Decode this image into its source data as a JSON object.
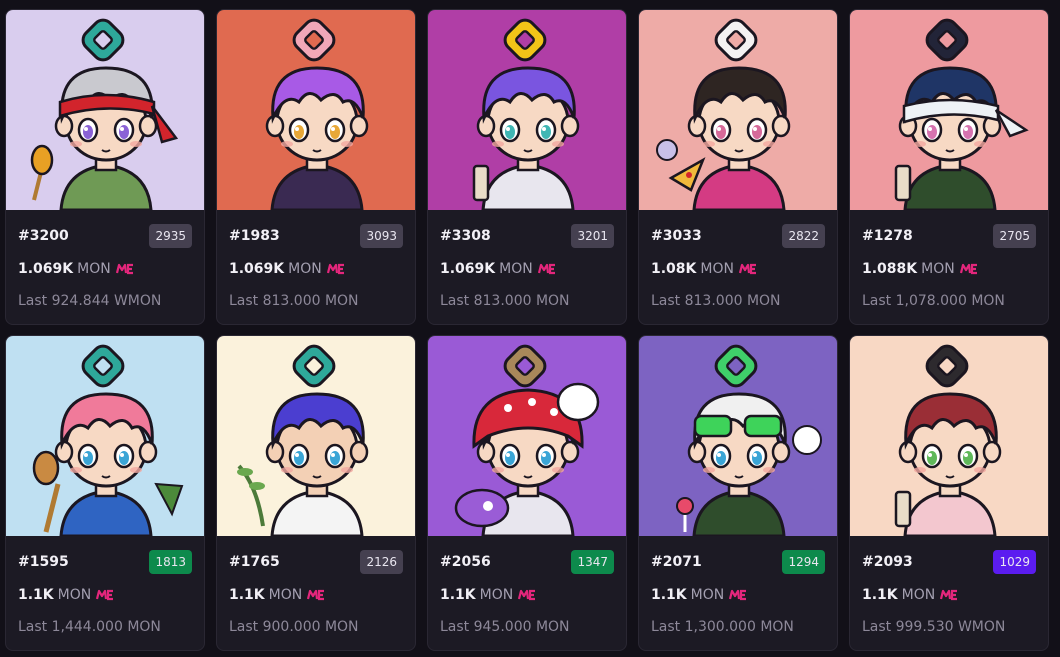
{
  "colors": {
    "page_bg": "#121018",
    "card_bg": "#1c1a24",
    "rank_default": "#454050",
    "rank_green": "#0d8a4c",
    "rank_purple": "#5b1cf0",
    "marketplace_brand": "#e4267c"
  },
  "icons": {
    "marketplace": "magic-eden-logo-icon"
  },
  "cards": [
    {
      "id": "#3200",
      "rank": "2935",
      "rank_style": "default",
      "price": "1.069K",
      "currency": "MON",
      "last": "Last 924.844 WMON",
      "art": {
        "bg": "#d9cdee",
        "hair": "#c9c9cf",
        "skin": "#f7d9c4",
        "shirt": "#6f9a55",
        "accessory": "red-bandana",
        "ring": "#2ea89a",
        "prop": "honey-dipper",
        "eyes": "#8a62d6"
      }
    },
    {
      "id": "#1983",
      "rank": "3093",
      "rank_style": "default",
      "price": "1.069K",
      "currency": "MON",
      "last": "Last 813.000 MON",
      "art": {
        "bg": "#e06a50",
        "hair": "#a85ae6",
        "skin": "#f7d9c4",
        "shirt": "#3a2a52",
        "accessory": "none",
        "ring": "#f1a7b8",
        "prop": "none",
        "eyes": "#e8a838"
      }
    },
    {
      "id": "#3308",
      "rank": "3201",
      "rank_style": "default",
      "price": "1.069K",
      "currency": "MON",
      "last": "Last 813.000 MON",
      "art": {
        "bg": "#b03ea6",
        "hair": "#7a55e0",
        "skin": "#f7d9c4",
        "shirt": "#e8e6ee",
        "accessory": "none",
        "ring": "#f2c418",
        "prop": "drink",
        "eyes": "#3fb6b4"
      }
    },
    {
      "id": "#3033",
      "rank": "2822",
      "rank_style": "default",
      "price": "1.08K",
      "currency": "MON",
      "last": "Last 813.000 MON",
      "art": {
        "bg": "#eeaba7",
        "hair": "#2e2522",
        "skin": "#f7d9c4",
        "shirt": "#d43b83",
        "accessory": "none",
        "ring": "#f4f2f2",
        "prop": "pizza",
        "eyes": "#d66a9a"
      }
    },
    {
      "id": "#1278",
      "rank": "2705",
      "rank_style": "default",
      "price": "1.088K",
      "currency": "MON",
      "last": "Last 1,078.000 MON",
      "art": {
        "bg": "#ee9a9f",
        "hair": "#1f3566",
        "skin": "#f7d9c4",
        "shirt": "#2f4d2c",
        "accessory": "white-bandage",
        "ring": "#222438",
        "prop": "scroll",
        "eyes": "#d673b0"
      }
    },
    {
      "id": "#1595",
      "rank": "1813",
      "rank_style": "green",
      "price": "1.1K",
      "currency": "MON",
      "last": "Last 1,444.000 MON",
      "art": {
        "bg": "#bfe0f2",
        "hair": "#f07a9a",
        "skin": "#f7d9c4",
        "shirt": "#2f64c2",
        "accessory": "none",
        "ring": "#2ea89a",
        "prop": "spoon",
        "eyes": "#3aa5d6"
      }
    },
    {
      "id": "#1765",
      "rank": "2126",
      "rank_style": "default",
      "price": "1.1K",
      "currency": "MON",
      "last": "Last 900.000 MON",
      "art": {
        "bg": "#fbf2dc",
        "hair": "#4b3ed0",
        "skin": "#f3d0b5",
        "shirt": "#f4f4f4",
        "accessory": "none",
        "ring": "#2ea89a",
        "prop": "branch",
        "eyes": "#3aa5d6"
      }
    },
    {
      "id": "#2056",
      "rank": "1347",
      "rank_style": "green",
      "price": "1.1K",
      "currency": "MON",
      "last": "Last 945.000 MON",
      "art": {
        "bg": "#9a5ad6",
        "hair": "#3b2f3f",
        "skin": "#f7d9c4",
        "shirt": "#e8e6ee",
        "accessory": "red-helmet",
        "ring": "#a8885a",
        "prop": "pet",
        "eyes": "#3aa5d6"
      }
    },
    {
      "id": "#2071",
      "rank": "1294",
      "rank_style": "green",
      "price": "1.1K",
      "currency": "MON",
      "last": "Last 1,300.000 MON",
      "art": {
        "bg": "#7d63c2",
        "hair": "#f0f0f0",
        "skin": "#f7d9c4",
        "shirt": "#2f4d2c",
        "accessory": "green-goggles",
        "ring": "#3fcf6a",
        "prop": "lollipop",
        "eyes": "#3aa5d6"
      }
    },
    {
      "id": "#2093",
      "rank": "1029",
      "rank_style": "purple",
      "price": "1.1K",
      "currency": "MON",
      "last": "Last 999.530 WMON",
      "art": {
        "bg": "#f8d8c4",
        "hair": "#9a2e36",
        "skin": "#f7d9c4",
        "shirt": "#f3c7cf",
        "accessory": "none",
        "ring": "#2d2a2e",
        "prop": "bottle",
        "eyes": "#5fb85a"
      }
    }
  ]
}
